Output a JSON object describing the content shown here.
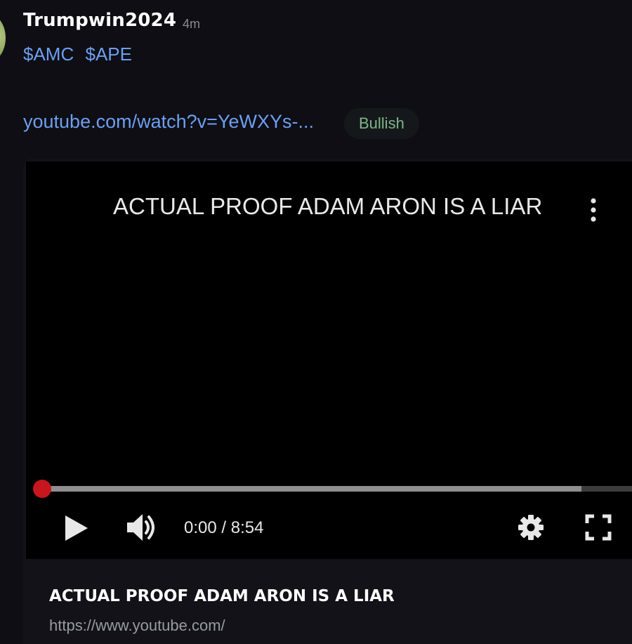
{
  "post": {
    "username": "Trumpwin2024",
    "time_ago": "4m",
    "tickers": [
      "$AMC",
      "$APE"
    ],
    "link_text": "youtube.com/watch?v=YeWXYs-...",
    "sentiment": "Bullish"
  },
  "colors": {
    "link": "#6d9ff0",
    "sentiment_text": "#7fb58a",
    "progress_knob": "#c8161e",
    "background": "#0e0e14"
  },
  "video": {
    "title": "ACTUAL PROOF ADAM ARON IS A LIAR",
    "current_time": "0:00",
    "separator": "/",
    "duration": "8:54",
    "buffered_fraction": 0.9,
    "played_fraction": 0.0,
    "icons": {
      "more": "more-vertical-icon",
      "play": "play-icon",
      "volume": "volume-icon",
      "settings": "gear-icon",
      "fullscreen": "fullscreen-icon"
    }
  },
  "card": {
    "title": "ACTUAL PROOF ADAM ARON IS A LIAR",
    "url": "https://www.youtube.com/"
  }
}
